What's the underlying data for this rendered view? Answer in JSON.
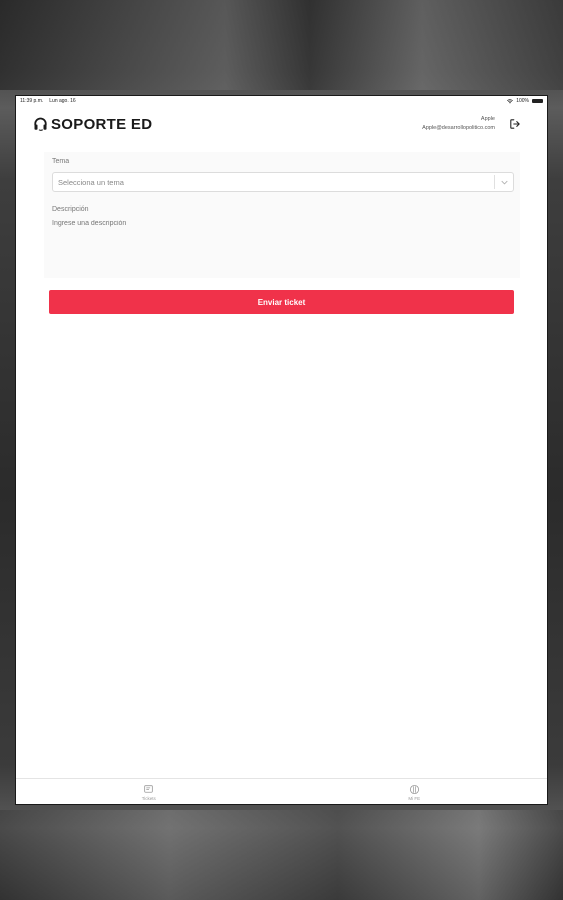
{
  "status_bar": {
    "time": "11:39 p.m.",
    "date": "Lun ago. 16",
    "battery": "100%"
  },
  "header": {
    "logo_text": "SOPORTE ED",
    "user_name": "Apple",
    "user_email": "Apple@desarrollopolitico.com"
  },
  "form": {
    "tema_label": "Tema",
    "tema_placeholder": "Selecciona un tema",
    "descripcion_label": "Descripción",
    "descripcion_placeholder": "Ingrese una descripción",
    "submit_label": "Enviar ticket"
  },
  "tabs": [
    {
      "label": "Tickets",
      "icon": "ticket-icon"
    },
    {
      "label": "Mi FE",
      "icon": "support-icon"
    }
  ],
  "colors": {
    "accent": "#f0324a",
    "text_dark": "#1a1a1a"
  }
}
